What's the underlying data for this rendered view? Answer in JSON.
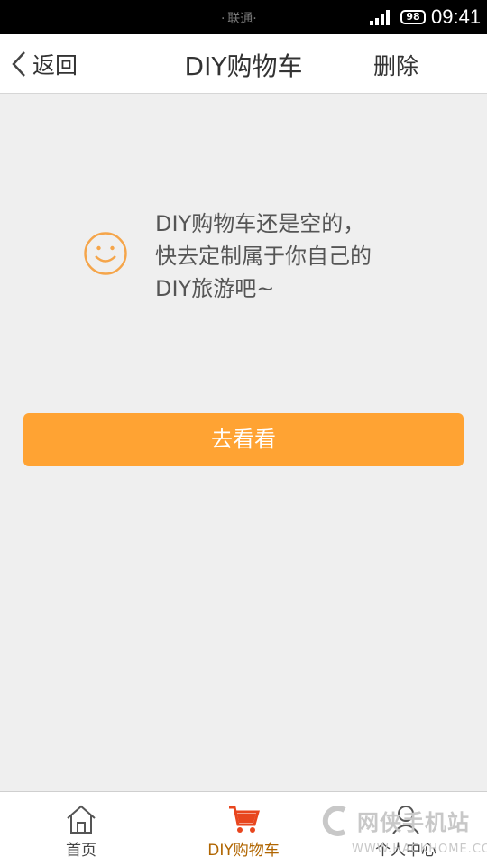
{
  "status_bar": {
    "carrier": "· 联通·",
    "battery": "98",
    "time": "09:41"
  },
  "header": {
    "back_label": "返回",
    "title": "DIY购物车",
    "delete_label": "删除"
  },
  "empty_state": {
    "line1": "DIY购物车还是空的，",
    "line2": "快去定制属于你自己的",
    "line3": "DIY旅游吧~"
  },
  "cta": {
    "label": "去看看"
  },
  "tabs": [
    {
      "label": "首页",
      "icon": "home-icon",
      "active": false
    },
    {
      "label": "DIY购物车",
      "icon": "cart-icon",
      "active": true
    },
    {
      "label": "个人中心",
      "icon": "user-icon",
      "active": false
    }
  ],
  "watermark": {
    "title": "网侠手机站",
    "url": "WWW.HACKHOME.COM"
  },
  "colors": {
    "accent": "#ffa333",
    "cart_active": "#e8461e",
    "active_label": "#b06500",
    "smile": "#f5a54a"
  }
}
